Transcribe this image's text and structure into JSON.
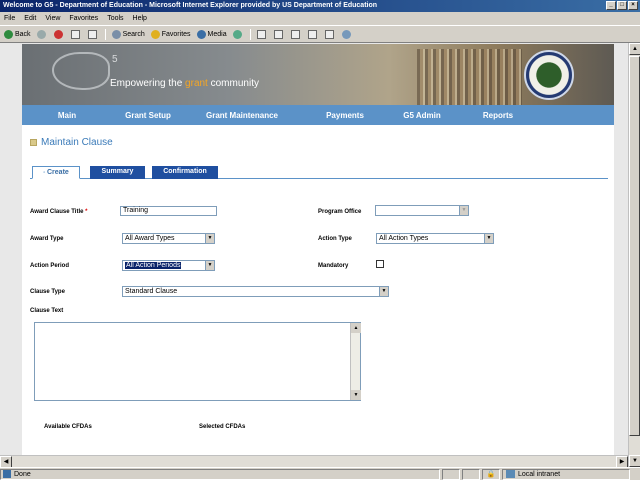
{
  "window": {
    "title": "Welcome to G5 - Department of Education - Microsoft Internet Explorer provided by US Department of Education",
    "minimize": "_",
    "maximize": "□",
    "close": "×"
  },
  "menu": [
    "File",
    "Edit",
    "View",
    "Favorites",
    "Tools",
    "Help"
  ],
  "toolbar": {
    "back": "Back",
    "search": "Search",
    "favorites": "Favorites",
    "media": "Media"
  },
  "banner": {
    "logo_sup": "5",
    "tagline_pre": "Empowering the ",
    "tagline_accent": "grant",
    "tagline_post": " community"
  },
  "nav": [
    "Main",
    "Grant Setup",
    "Grant Maintenance",
    "Payments",
    "G5 Admin",
    "Reports"
  ],
  "page": {
    "title": "Maintain Clause",
    "tabs": [
      {
        "label": "Create",
        "active": true
      },
      {
        "label": "Summary",
        "active": false
      },
      {
        "label": "Confirmation",
        "active": false
      }
    ]
  },
  "form": {
    "award_clause_title_label": "Award Clause Title",
    "required_mark": "*",
    "award_clause_title_value": "Training",
    "program_office_label": "Program Office",
    "program_office_value": "",
    "award_type_label": "Award Type",
    "award_type_value": "All Award Types",
    "action_type_label": "Action Type",
    "action_type_value": "All Action Types",
    "action_period_label": "Action Period",
    "action_period_value": "All Action Periods",
    "mandatory_label": "Mandatory",
    "clause_type_label": "Clause Type",
    "clause_type_value": "Standard Clause",
    "clause_text_label": "Clause Text",
    "available_cfdas_label": "Available CFDAs",
    "selected_cfdas_label": "Selected CFDAs"
  },
  "status": {
    "text": "Done",
    "zone": "Local intranet"
  },
  "colors": {
    "nav": "#5b92c8",
    "tab_inactive": "#1f4fa0",
    "title": "#3a7ab8",
    "accent": "#f5a623"
  }
}
